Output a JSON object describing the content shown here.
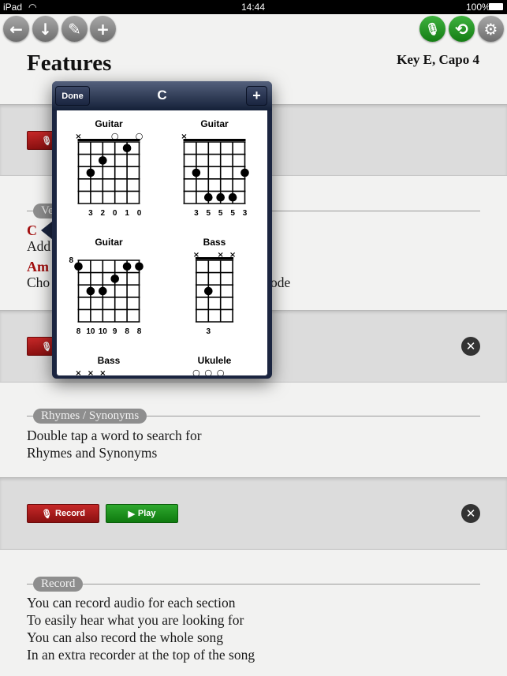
{
  "status_bar": {
    "device": "iPad",
    "time": "14:44",
    "battery": "100%"
  },
  "toolbar": {
    "left": [
      {
        "name": "back",
        "glyph": "←"
      },
      {
        "name": "download",
        "glyph": "↓"
      },
      {
        "name": "edit",
        "glyph": "✎"
      },
      {
        "name": "add",
        "glyph": "+"
      }
    ],
    "right": [
      {
        "name": "microphone",
        "glyph": "🎙"
      },
      {
        "name": "repeat",
        "glyph": "⟲"
      },
      {
        "name": "settings",
        "glyph": "⚙"
      }
    ]
  },
  "song": {
    "title": "Features",
    "key": "Key E, Capo 4"
  },
  "sections": {
    "verse": {
      "label": "Ve",
      "chord1": "C",
      "line1": "Add",
      "chord2": "Am",
      "line2": "Cho",
      "line2_end": "ode"
    },
    "rhymes": {
      "label": "Rhymes / Synonyms",
      "lines": [
        "Double tap a word to search for",
        "Rhymes and Synonyms"
      ]
    },
    "record": {
      "label": "Record",
      "lines": [
        "You can record audio for each section",
        "To easily hear what you are looking for",
        "You can also record the whole song",
        "In an extra recorder at the top of the song"
      ]
    }
  },
  "buttons": {
    "record": "Record",
    "play": "Play",
    "close": "✕"
  },
  "popover": {
    "title": "C",
    "done": "Done",
    "add": "+",
    "chords": [
      {
        "instrument": "Guitar",
        "strings": 6,
        "nut": true,
        "markers": [
          "x",
          "",
          "",
          "o",
          "",
          "o"
        ],
        "dots": [
          [
            1,
            3
          ],
          [
            2,
            2
          ],
          [
            4,
            1
          ]
        ],
        "labels": [
          "",
          "3",
          "2",
          "0",
          "1",
          "0"
        ]
      },
      {
        "instrument": "Guitar",
        "strings": 6,
        "nut": true,
        "markers": [
          "x",
          "",
          "",
          "",
          "",
          ""
        ],
        "dots": [
          [
            1,
            3
          ],
          [
            2,
            5
          ],
          [
            3,
            5
          ],
          [
            4,
            5
          ],
          [
            5,
            3
          ]
        ],
        "labels": [
          "",
          "3",
          "5",
          "5",
          "5",
          "3"
        ]
      },
      {
        "instrument": "Guitar",
        "strings": 6,
        "nut": false,
        "base_fret": "8",
        "markers": [
          "",
          "",
          "",
          "",
          "",
          ""
        ],
        "dots": [
          [
            0,
            1
          ],
          [
            1,
            3
          ],
          [
            2,
            3
          ],
          [
            3,
            2
          ],
          [
            4,
            1
          ],
          [
            5,
            1
          ]
        ],
        "labels": [
          "8",
          "10",
          "10",
          "9",
          "8",
          "8"
        ]
      },
      {
        "instrument": "Bass",
        "strings": 4,
        "nut": true,
        "markers": [
          "x",
          "",
          "x",
          "x"
        ],
        "dots": [
          [
            1,
            3
          ]
        ],
        "labels": [
          "",
          "3",
          "",
          ""
        ]
      },
      {
        "instrument": "Bass",
        "strings": 6,
        "nut": true,
        "markers": [
          "x",
          "x",
          "x",
          "",
          "",
          ""
        ],
        "dots": [],
        "labels": []
      },
      {
        "instrument": "Ukulele",
        "strings": 4,
        "nut": true,
        "markers": [
          "o",
          "o",
          "o",
          ""
        ],
        "dots": [],
        "labels": []
      }
    ]
  }
}
